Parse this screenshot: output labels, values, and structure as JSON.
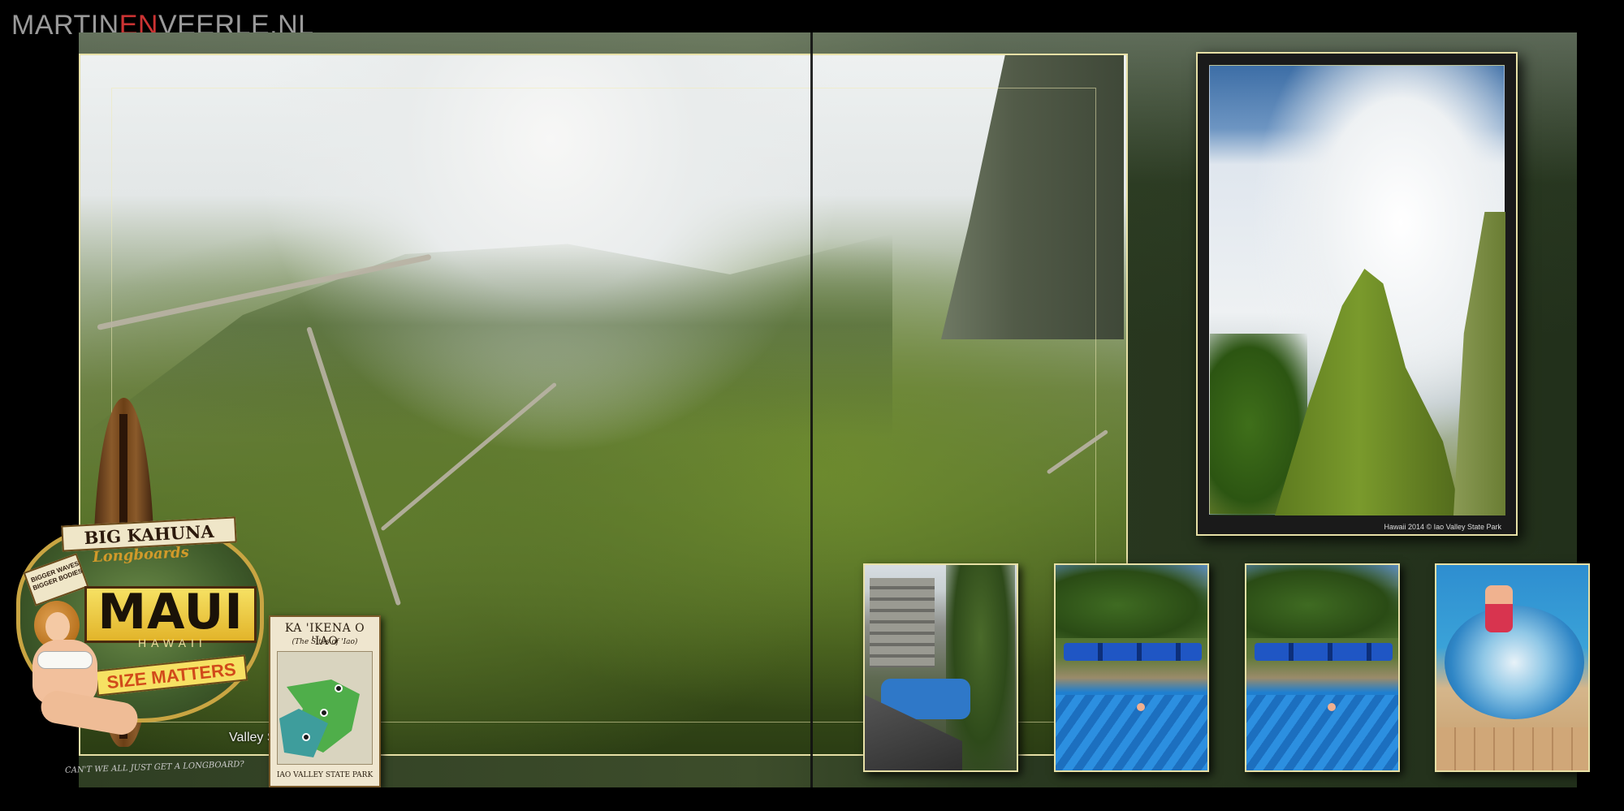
{
  "header": {
    "brand_part1": "MARTIN",
    "brand_part2": "EN",
    "brand_part3": "VEERLE.NL"
  },
  "main_photo": {
    "overlay_text": "Valley S"
  },
  "needle_photo": {
    "caption": "Hawaii 2014 © Iao Valley State Park"
  },
  "sticker": {
    "banner": "BIG KAHUNA",
    "banner_sub": "Longboards",
    "side_ribbon": "BIGGER WAVES BIGGER BODIES",
    "title": "MAUI",
    "subtitle": "HAWAII",
    "size_banner": "SIZE MATTERS",
    "tagline": "CAN'T WE ALL JUST GET A LONGBOARD?"
  },
  "map_sign": {
    "title": "KA 'IKENA O 'IAO",
    "subtitle": "(The Sites of 'Iao)",
    "footer": "IAO VALLEY STATE PARK"
  },
  "colors": {
    "accent_red": "#cc3333",
    "frame_gold": "#e7e0a6"
  }
}
